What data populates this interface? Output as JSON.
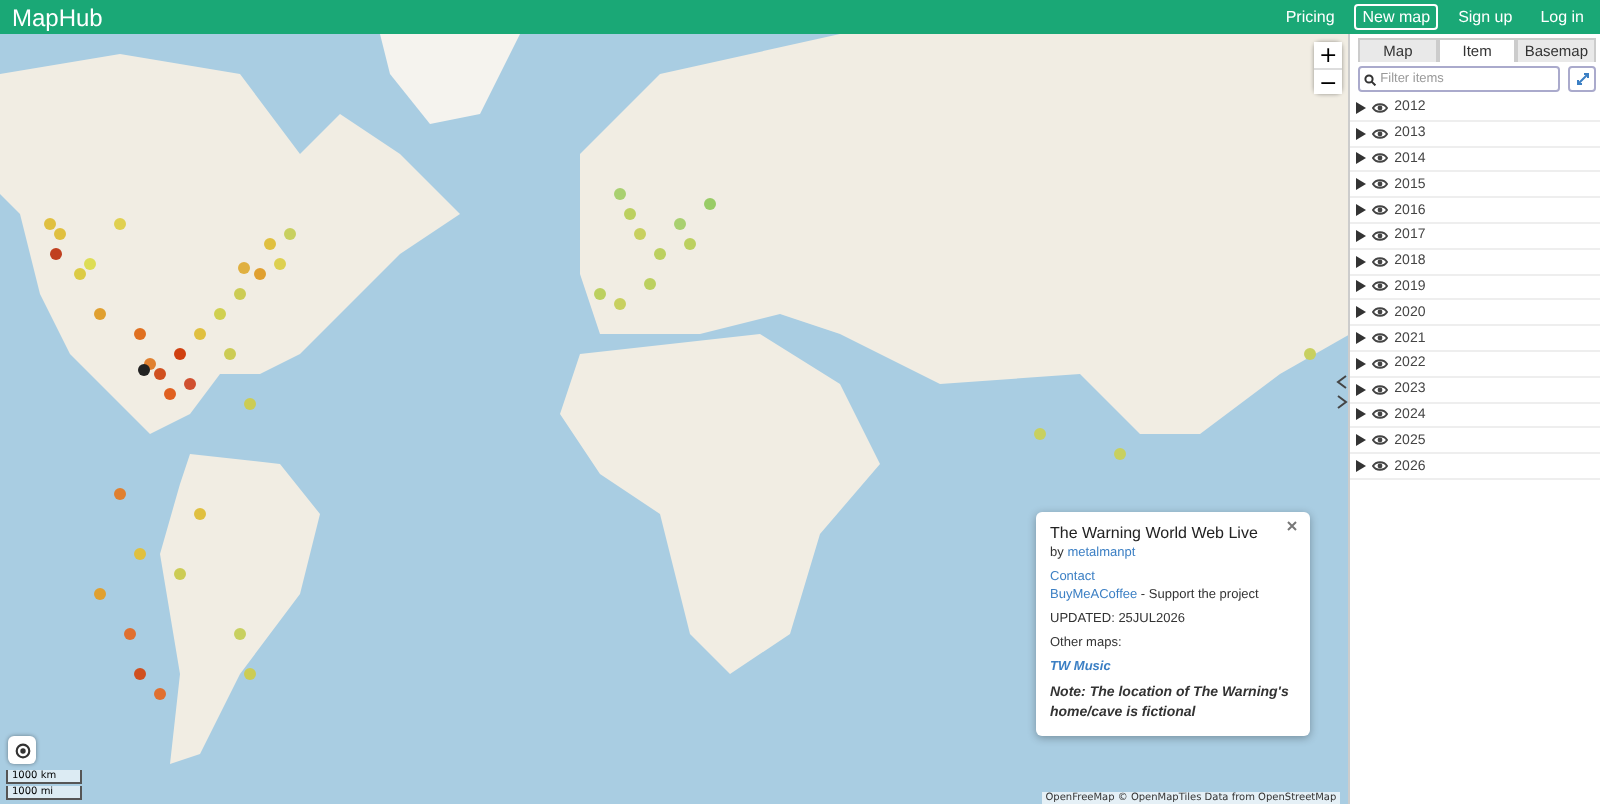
{
  "header": {
    "logo": "MapHub",
    "nav": [
      {
        "label": "Pricing",
        "selected": false
      },
      {
        "label": "New map",
        "selected": true
      },
      {
        "label": "Sign up",
        "selected": false
      },
      {
        "label": "Log in",
        "selected": false
      }
    ]
  },
  "map": {
    "zoom_in": "+",
    "zoom_out": "−",
    "scale": [
      "1000 km",
      "1000 mi"
    ],
    "attribution": "OpenFreeMap © OpenMapTiles Data from OpenStreetMap"
  },
  "popup": {
    "title": "The Warning World Web Live",
    "byline": {
      "prefix": "by",
      "author": "metalmanpt"
    },
    "contact": "Contact",
    "support": {
      "link": "BuyMeACoffee",
      "text": "- Support the project"
    },
    "updated": "UPDATED: 25JUL2026",
    "other_maps_label": "Other maps:",
    "other_maps": [
      "TW Music"
    ],
    "note": "Note: The location of The Warning's home/cave is fictional"
  },
  "sidebar": {
    "tabs": [
      {
        "label": "Map",
        "selected": false
      },
      {
        "label": "Item",
        "selected": true
      },
      {
        "label": "Basemap",
        "selected": false
      }
    ],
    "filter": {
      "placeholder": "Filter items"
    },
    "items": [
      {
        "label": "2012",
        "expanded": false,
        "visible": true
      },
      {
        "label": "2013",
        "expanded": false,
        "visible": true
      },
      {
        "label": "2014",
        "expanded": false,
        "visible": true
      },
      {
        "label": "2015",
        "expanded": false,
        "visible": true
      },
      {
        "label": "2016",
        "expanded": false,
        "visible": true
      },
      {
        "label": "2017",
        "expanded": false,
        "visible": true
      },
      {
        "label": "2018",
        "expanded": false,
        "visible": true
      },
      {
        "label": "2019",
        "expanded": false,
        "visible": true
      },
      {
        "label": "2020",
        "expanded": false,
        "visible": true
      },
      {
        "label": "2021",
        "expanded": false,
        "visible": true
      },
      {
        "label": "2022",
        "expanded": false,
        "visible": true
      },
      {
        "label": "2023",
        "expanded": false,
        "visible": true
      },
      {
        "label": "2024",
        "expanded": false,
        "visible": true
      },
      {
        "label": "2025",
        "expanded": false,
        "visible": true
      },
      {
        "label": "2026",
        "expanded": false,
        "visible": true
      }
    ]
  }
}
